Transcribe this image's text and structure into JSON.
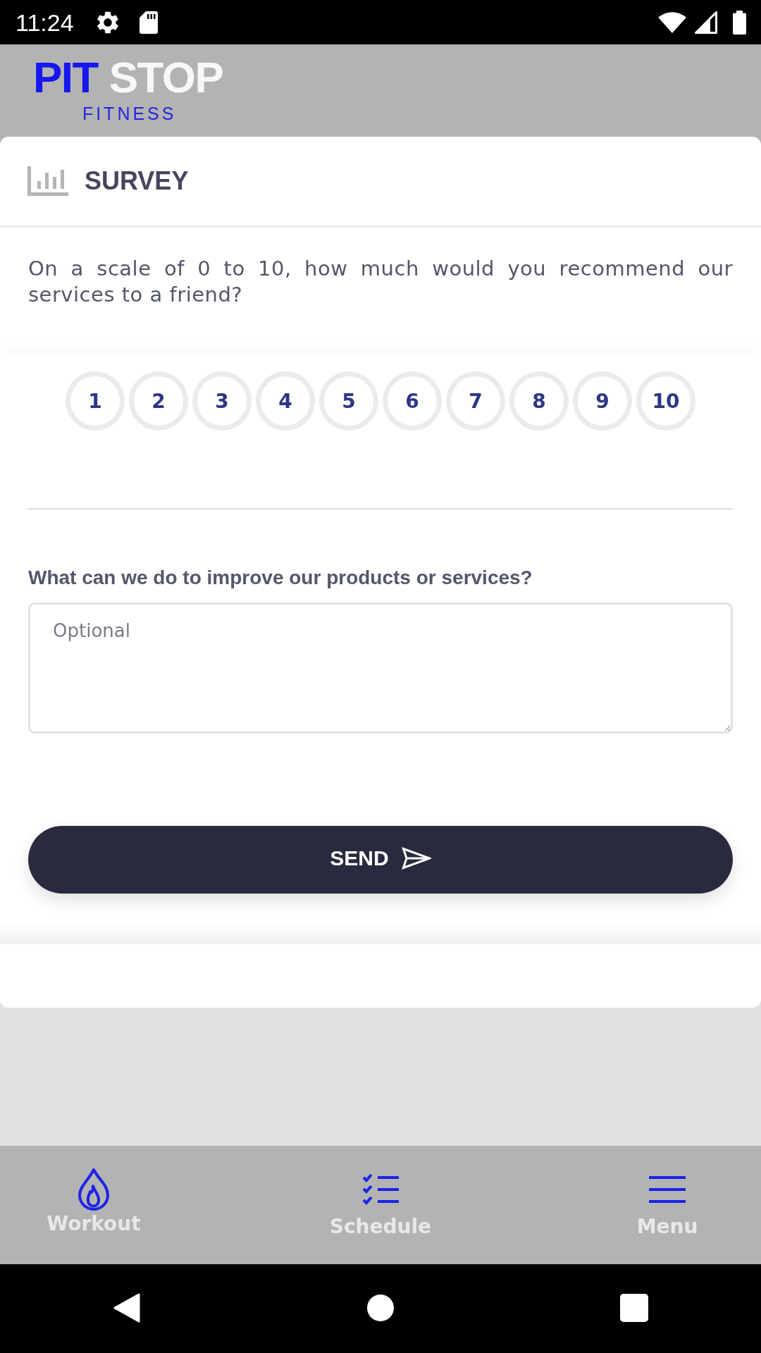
{
  "status_bar": {
    "time": "11:24"
  },
  "header": {
    "logo": {
      "words": [
        "PIT",
        "STOP"
      ],
      "tagline": "FITNESS"
    }
  },
  "survey": {
    "title": "SURVEY",
    "question": "On a scale of 0 to 10, how much would you recommend our services to a friend?",
    "rating": [
      {
        "label": "1",
        "selected": false
      },
      {
        "label": "2",
        "selected": false
      },
      {
        "label": "3",
        "selected": false
      },
      {
        "label": "4",
        "selected": false
      },
      {
        "label": "5",
        "selected": false
      },
      {
        "label": "6",
        "selected": false
      },
      {
        "label": "7",
        "selected": false
      },
      {
        "label": "8",
        "selected": false
      },
      {
        "label": "9",
        "selected": false
      },
      {
        "label": "10",
        "selected": false
      }
    ],
    "feedback": {
      "label": "What can we do to improve our products or services?",
      "placeholder": "Optional"
    },
    "send_button": {
      "label": "SEND"
    }
  },
  "bottom_nav": [
    {
      "label": "Workout",
      "selected": false
    },
    {
      "label": "Schedule",
      "selected": false
    },
    {
      "label": "Menu",
      "selected": false
    }
  ]
}
